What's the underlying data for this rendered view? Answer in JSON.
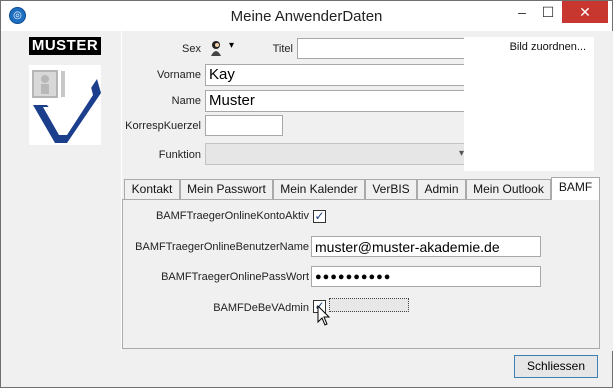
{
  "window": {
    "title": "Meine AnwenderDaten",
    "app_icon": "app-logo-icon",
    "controls": {
      "minimize": "–",
      "maximize": "☐",
      "close": "✕"
    }
  },
  "side": {
    "badge": "MUSTER",
    "picture_icon": "user-checkmark-icon"
  },
  "form": {
    "sex_label": "Sex",
    "sex_icon": "person-icon",
    "sex_dropdown": "▾",
    "titel_label": "Titel",
    "titel_value": "",
    "vorname_label": "Vorname",
    "vorname_value": "Kay",
    "name_label": "Name",
    "name_value": "Muster",
    "korresp_label": "KorrespKuerzel",
    "korresp_value": "",
    "funktion_label": "Funktion",
    "funktion_value": "",
    "funktion_dropdown": "▾",
    "photo_link": "Bild zuordnen..."
  },
  "tabs": [
    {
      "label": "Kontakt"
    },
    {
      "label": "Mein Passwort"
    },
    {
      "label": "Mein Kalender"
    },
    {
      "label": "VerBIS"
    },
    {
      "label": "Admin"
    },
    {
      "label": "Mein Outlook"
    },
    {
      "label": "BAMF",
      "active": true
    }
  ],
  "bamf": {
    "konto_aktiv_label": "BAMFTraegerOnlineKontoAktiv",
    "konto_aktiv_checked": true,
    "benutzer_label": "BAMFTraegerOnlineBenutzerName",
    "benutzer_value": "muster@muster-akademie.de",
    "passwort_label": "BAMFTraegerOnlinePassWort",
    "passwort_value": "●●●●●●●●●●",
    "debev_label": "BAMFDeBeVAdmin",
    "debev_checked": true,
    "check_mark": "✓"
  },
  "footer": {
    "close_button": "Schliessen"
  }
}
